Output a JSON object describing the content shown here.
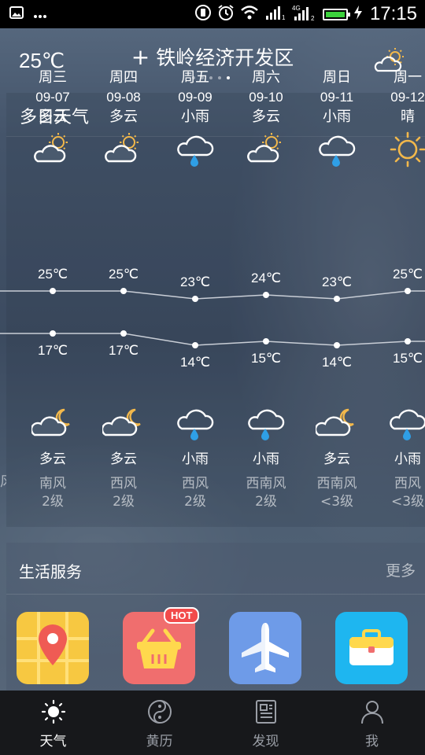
{
  "status_bar": {
    "time": "17:15",
    "network": "4G"
  },
  "header": {
    "current_temp": "25℃",
    "city": "铁岭经济开发区",
    "add_symbol": "+",
    "page_dots": 5,
    "active_dot": 4
  },
  "multi_day": {
    "title": "多日天气",
    "days": [
      {
        "weekday": "周三",
        "date": "09-07",
        "day_cond": "多云",
        "day_icon": "partly-cloudy-sun-icon",
        "high": "25℃",
        "low": "17℃",
        "night_icon": "partly-cloudy-moon-icon",
        "night_cond": "多云",
        "wind_dir": "南风",
        "wind_level": "2级"
      },
      {
        "weekday": "周四",
        "date": "09-08",
        "day_cond": "多云",
        "day_icon": "partly-cloudy-sun-icon",
        "high": "25℃",
        "low": "17℃",
        "night_icon": "partly-cloudy-moon-icon",
        "night_cond": "多云",
        "wind_dir": "西风",
        "wind_level": "2级"
      },
      {
        "weekday": "周五",
        "date": "09-09",
        "day_cond": "小雨",
        "day_icon": "light-rain-icon",
        "high": "23℃",
        "low": "14℃",
        "night_icon": "light-rain-icon",
        "night_cond": "小雨",
        "wind_dir": "西风",
        "wind_level": "2级"
      },
      {
        "weekday": "周六",
        "date": "09-10",
        "day_cond": "多云",
        "day_icon": "partly-cloudy-sun-icon",
        "high": "24℃",
        "low": "15℃",
        "night_icon": "light-rain-icon",
        "night_cond": "小雨",
        "wind_dir": "西南风",
        "wind_level": "2级"
      },
      {
        "weekday": "周日",
        "date": "09-11",
        "day_cond": "小雨",
        "day_icon": "light-rain-icon",
        "high": "23℃",
        "low": "14℃",
        "night_icon": "partly-cloudy-moon-icon",
        "night_cond": "多云",
        "wind_dir": "西南风",
        "wind_level": "<3级"
      },
      {
        "weekday": "周一",
        "date": "09-12",
        "day_cond": "晴",
        "day_icon": "sunny-icon",
        "high": "25℃",
        "low": "15℃",
        "night_icon": "light-rain-icon",
        "night_cond": "小雨",
        "wind_dir": "西风",
        "wind_level": "<3级"
      }
    ],
    "prev_wind_partial": "风",
    "high_values": [
      25,
      25,
      23,
      24,
      23,
      25
    ],
    "low_values": [
      17,
      17,
      14,
      15,
      14,
      15
    ],
    "line_color": "#c9ced6"
  },
  "services": {
    "title": "生活服务",
    "more": "更多",
    "hot_badge": "HOT",
    "tiles": [
      {
        "icon": "map-pin-icon",
        "color": "#f7c841"
      },
      {
        "icon": "shopping-basket-icon",
        "color": "#f06e6e"
      },
      {
        "icon": "airplane-icon",
        "color": "#6e9be8"
      },
      {
        "icon": "briefcase-icon",
        "color": "#1eb6f0"
      }
    ]
  },
  "bottom_nav": {
    "items": [
      {
        "label": "天气",
        "icon": "sun-icon",
        "active": true
      },
      {
        "label": "黄历",
        "icon": "yin-yang-icon",
        "active": false
      },
      {
        "label": "发现",
        "icon": "news-icon",
        "active": false
      },
      {
        "label": "我",
        "icon": "person-icon",
        "active": false
      }
    ]
  }
}
